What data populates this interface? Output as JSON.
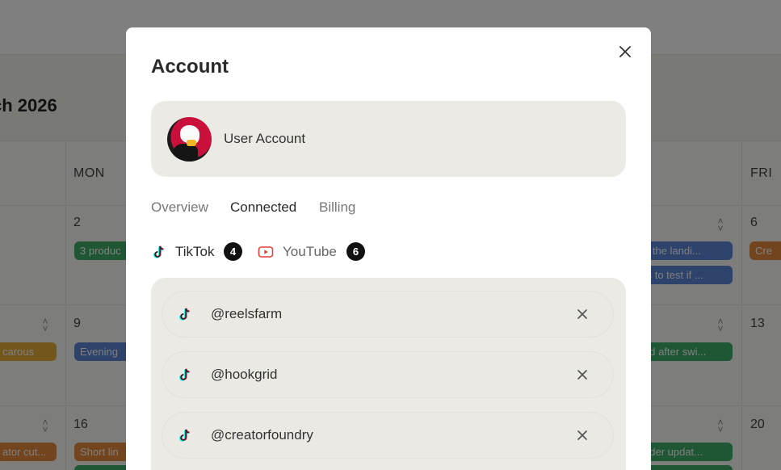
{
  "background": {
    "month_title": "ch 2026",
    "day_headers": [
      "MON",
      "FRI"
    ],
    "day_numbers": [
      "2",
      "6",
      "9",
      "13",
      "16",
      "20"
    ],
    "events": [
      {
        "label": "3 produc",
        "color": "#3fae6a"
      },
      {
        "label": "Cre",
        "color": "#e58a3c"
      },
      {
        "label": "t: the landi...",
        "color": "#5b86d9"
      },
      {
        "label": "ts to test if ...",
        "color": "#5b86d9"
      },
      {
        "label": "carous",
        "color": "#e6ad35"
      },
      {
        "label": "Evening",
        "color": "#5b86d9"
      },
      {
        "label": "ed after swi...",
        "color": "#3fae6a"
      },
      {
        "label": "ator cut...",
        "color": "#e58a3c"
      },
      {
        "label": "Short lin",
        "color": "#e58a3c"
      },
      {
        "label": "nder updat...",
        "color": "#3fae6a"
      }
    ]
  },
  "modal": {
    "title": "Account",
    "close_icon": "close-icon",
    "account": {
      "name": "User Account",
      "avatar": "avatar"
    },
    "tabs": [
      {
        "label": "Overview",
        "active": false
      },
      {
        "label": "Connected",
        "active": true
      },
      {
        "label": "Billing",
        "active": false
      }
    ],
    "platforms": [
      {
        "name": "TikTok",
        "count": "4",
        "icon": "tiktok-icon",
        "active": true
      },
      {
        "name": "YouTube",
        "count": "6",
        "icon": "youtube-icon",
        "active": false
      }
    ],
    "connected_accounts": [
      {
        "handle": "@reelsfarm",
        "icon": "tiktok-icon"
      },
      {
        "handle": "@hookgrid",
        "icon": "tiktok-icon"
      },
      {
        "handle": "@creatorfoundry",
        "icon": "tiktok-icon"
      }
    ]
  },
  "colors": {
    "overlay": "rgba(0,0,0,0.5)",
    "card_bg": "#ebeae4",
    "badge_bg": "#111111",
    "youtube_red": "#e0403c"
  }
}
